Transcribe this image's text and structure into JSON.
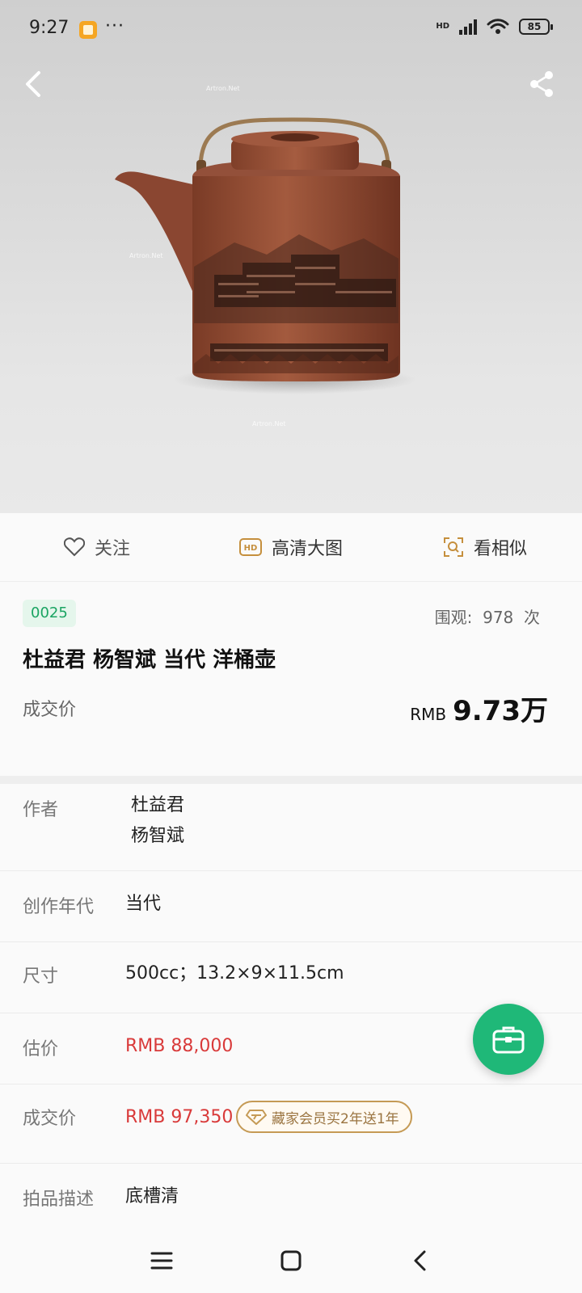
{
  "status_bar": {
    "time": "9:27",
    "more": "···",
    "network": "HD",
    "battery": "85"
  },
  "hero": {
    "watermark": "Artron.Net",
    "image_icon": "teapot-photo"
  },
  "actions": [
    {
      "label": "关注",
      "icon": "heart-icon"
    },
    {
      "label": "高清大图",
      "icon": "hd-icon"
    },
    {
      "label": "看相似",
      "icon": "search-similar-icon"
    }
  ],
  "lot": {
    "number": "0025",
    "views_label": "围观:",
    "views_count": "978",
    "views_unit": "次",
    "title": "杜益君 杨智斌 当代 洋桶壶",
    "price_label": "成交价",
    "price_currency": "RMB",
    "price_value": "9.73万"
  },
  "details": {
    "author_label": "作者",
    "author_1": "杜益君",
    "author_2": "杨智斌",
    "era_label": "创作年代",
    "era_value": "当代",
    "size_label": "尺寸",
    "size_value": "500cc；13.2×9×11.5cm",
    "estimate_label": "估价",
    "estimate_value": "RMB  88,000",
    "sold_label": "成交价",
    "sold_value": "RMB 97,350",
    "member_chip": "藏家会员买2年送1年",
    "desc_label": "拍品描述",
    "desc_value": "底槽清"
  },
  "colors": {
    "accent_green": "#1fb878",
    "price_red": "#d93a3a",
    "gold": "#c59a55"
  }
}
